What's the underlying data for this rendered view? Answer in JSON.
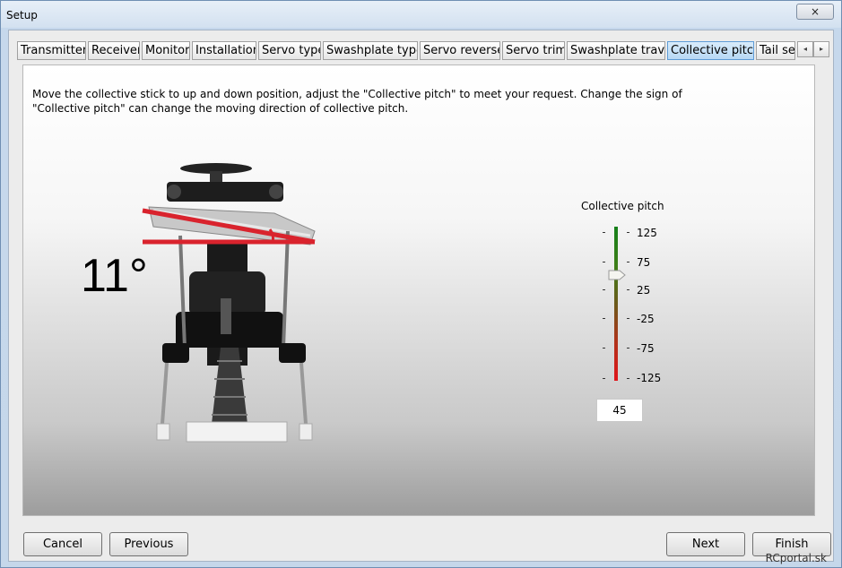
{
  "window": {
    "title": "Setup",
    "close_label": "×"
  },
  "tabs": [
    {
      "label": "Transmitter"
    },
    {
      "label": "Receiver"
    },
    {
      "label": "Monitor"
    },
    {
      "label": "Installation"
    },
    {
      "label": "Servo type"
    },
    {
      "label": "Swashplate type"
    },
    {
      "label": "Servo reverse"
    },
    {
      "label": "Servo trim"
    },
    {
      "label": "Swashplate travel"
    },
    {
      "label": "Collective pitch",
      "active": true
    },
    {
      "label": "Tail se"
    }
  ],
  "tab_scroll": {
    "left_icon": "◂",
    "right_icon": "▸"
  },
  "panel": {
    "instruction": "Move the collective stick to up and down position, adjust the \"Collective pitch\" to meet your request. Change the sign of \"Collective pitch\" can change the moving direction of collective pitch.",
    "angle_display": "11°"
  },
  "collective_slider": {
    "title": "Collective pitch",
    "scale_labels": [
      "125",
      "75",
      "25",
      "-25",
      "-75",
      "-125"
    ],
    "min": -125,
    "max": 125,
    "value": 45,
    "value_text": "45"
  },
  "buttons": {
    "cancel": "Cancel",
    "previous": "Previous",
    "next": "Next",
    "finish": "Finish"
  },
  "watermark": "RCportal.sk",
  "colors": {
    "active_tab": "#b7d8f4",
    "pitch_line": "#d9232d"
  }
}
